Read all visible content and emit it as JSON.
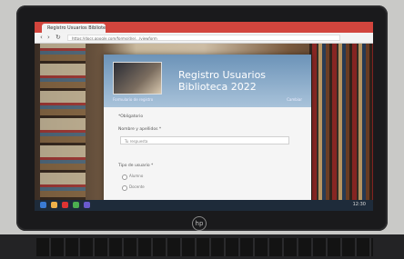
{
  "browser": {
    "tab_title": "Registro Usuarios Biblioteca",
    "url": "https://docs.google.com/forms/d/e/.../viewform"
  },
  "form": {
    "title": "Registro Usuarios Biblioteca 2022",
    "subtitle": "Formulario de registro",
    "account_label": "Cambiar",
    "required_note": "*Obligatorio",
    "q1_label": "Nombre y apellidos *",
    "q1_placeholder": "Tu respuesta",
    "q2_label": "Tipo de usuario *",
    "q2_options": [
      "Alumno",
      "Docente"
    ]
  },
  "taskbar": {
    "clock": "12:30"
  },
  "hardware": {
    "brand_logo": "hp"
  },
  "colors": {
    "browser_red": "#d2453d",
    "banner_blue": "#6c93b8"
  }
}
